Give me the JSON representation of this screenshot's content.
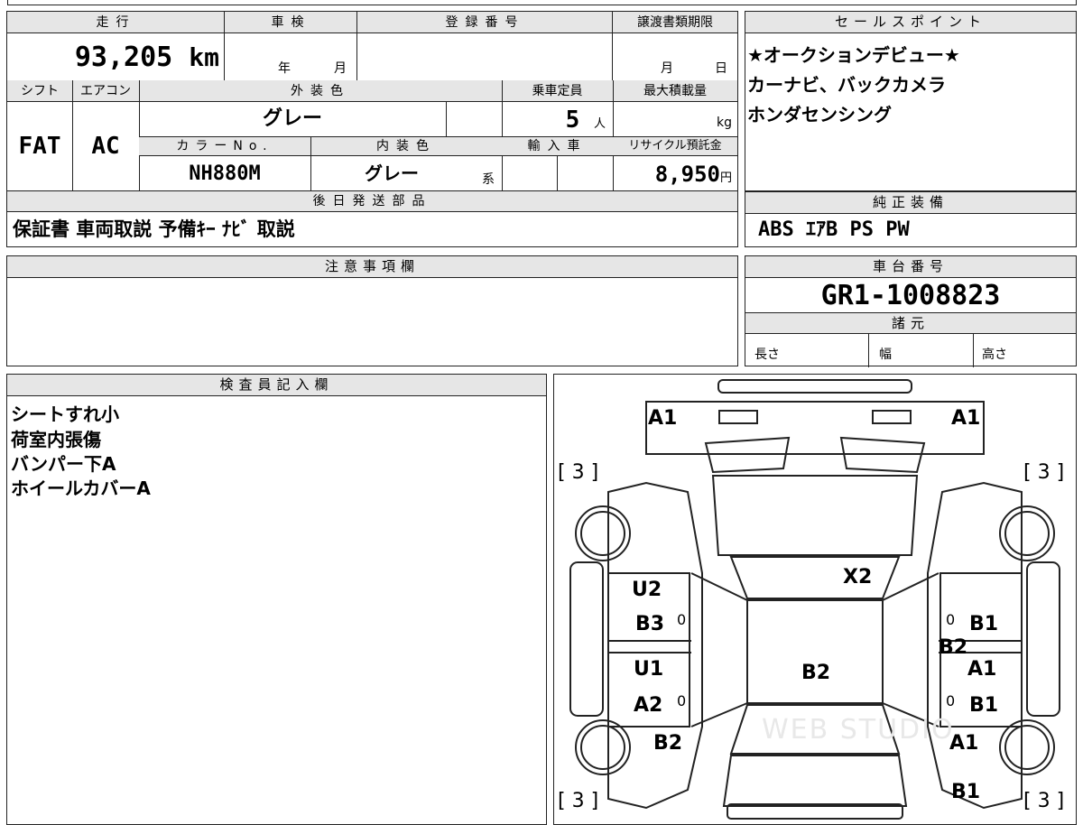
{
  "mileage": {
    "label": "走行",
    "value": "93,205",
    "unit": "km"
  },
  "inspection": {
    "label": "車検",
    "year_unit": "年",
    "month_unit": "月"
  },
  "registration_number": {
    "label": "登録番号",
    "value": ""
  },
  "transfer_deadline": {
    "label": "譲渡書類期限",
    "month_unit": "月",
    "day_unit": "日"
  },
  "sales_points": {
    "label": "セールスポイント",
    "lines": [
      "★オークションデビュー★",
      "カーナビ、バックカメラ",
      "ホンダセンシング"
    ]
  },
  "shift": {
    "label": "シフト",
    "value": "FAT"
  },
  "aircon": {
    "label": "エアコン",
    "value": "AC"
  },
  "exterior_color": {
    "label": "外装色",
    "value": "グレー"
  },
  "capacity": {
    "label": "乗車定員",
    "value": "5",
    "unit": "人"
  },
  "max_load": {
    "label": "最大積載量",
    "unit": "kg"
  },
  "color_no": {
    "label": "カラーNo.",
    "value": "NH880M"
  },
  "interior_color": {
    "label": "内装色",
    "value": "グレー",
    "suffix": "系"
  },
  "import": {
    "label": "輸入車"
  },
  "recycle_fee": {
    "label": "リサイクル預託金",
    "value": "8,950",
    "unit": "円"
  },
  "later_items": {
    "label": "後日発送部品",
    "value": "保証書 車両取説 予備ｷｰ ﾅﾋﾞ 取説"
  },
  "standard_equipment": {
    "label": "純正装備",
    "value": "ABS ｴｱB PS PW"
  },
  "notes": {
    "label": "注意事項欄"
  },
  "chassis_number": {
    "label": "車台番号",
    "value": "GR1-1008823"
  },
  "specs": {
    "label": "諸元",
    "length": "長さ",
    "width": "幅",
    "height": "高さ"
  },
  "inspector_notes": {
    "label": "検査員記入欄",
    "lines": [
      "シートすれ小",
      "荷室内張傷",
      "バンパー下A",
      "ホイールカバーA"
    ]
  },
  "diagram": {
    "tags": [
      "A1",
      "A1",
      "[ 3 ]",
      "[ 3 ]",
      "X2",
      "U2",
      "B3",
      "B1",
      "B2",
      "U1",
      "B2",
      "A1",
      "A2",
      "B1",
      "B2",
      "A1",
      "B1",
      "[ 3 ]",
      "[ 3 ]"
    ],
    "zeros": [
      "0",
      "0",
      "0",
      "0"
    ],
    "watermark": "WEB STUDIO"
  }
}
